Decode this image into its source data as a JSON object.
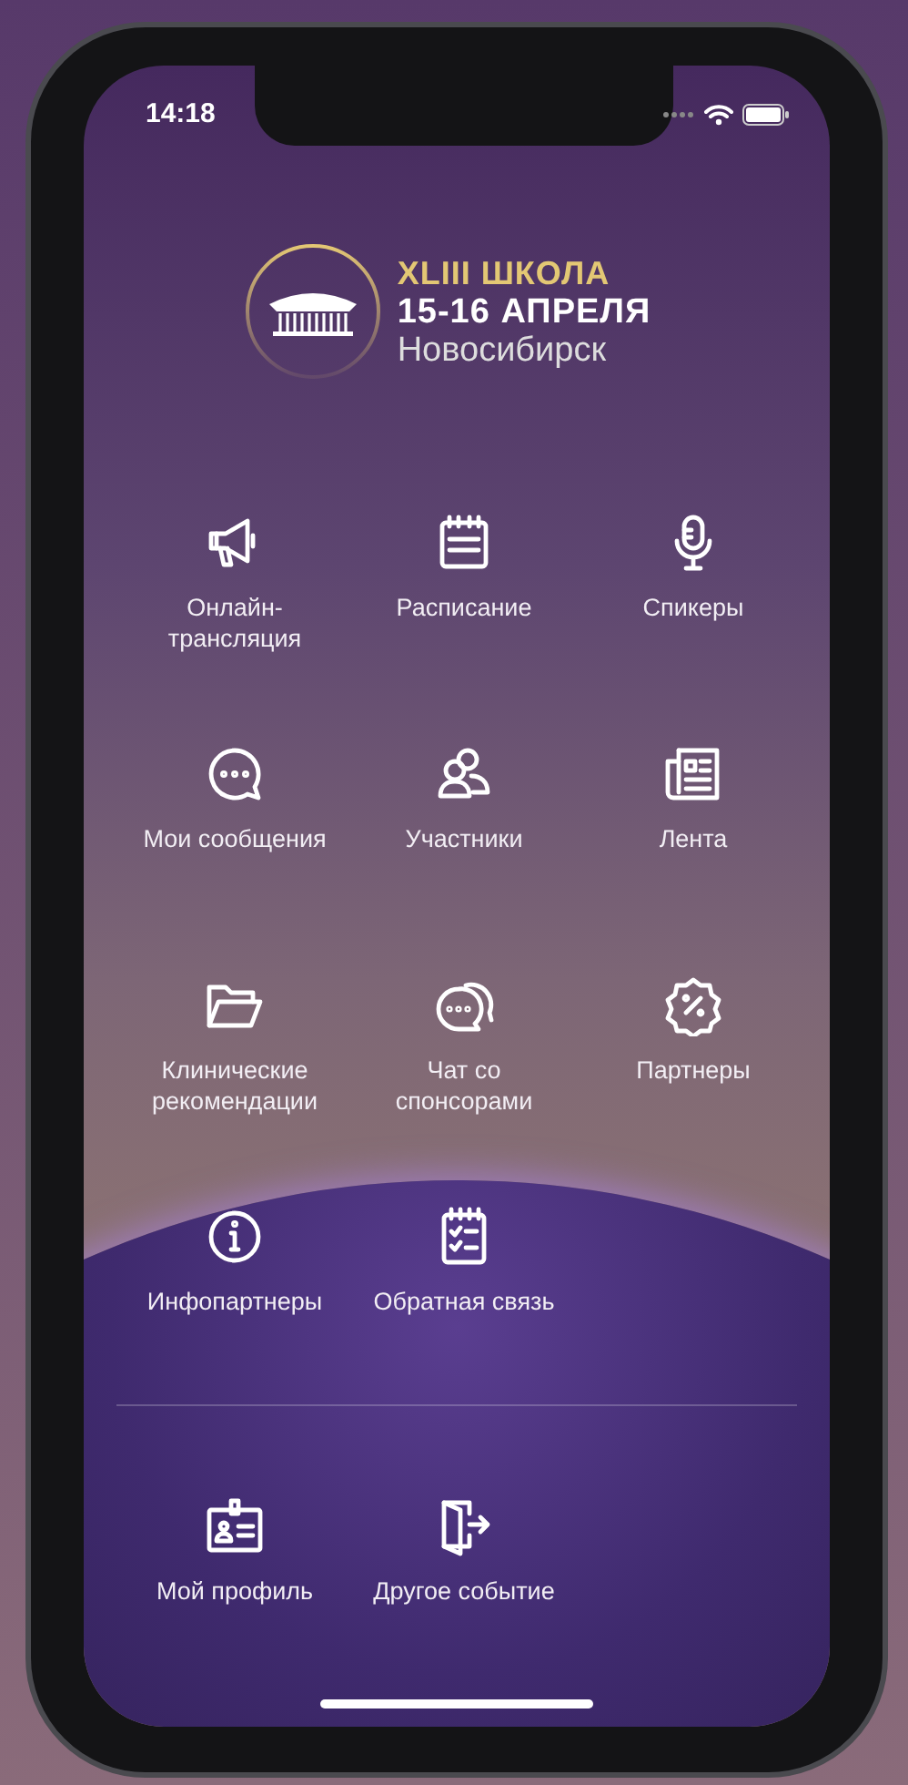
{
  "status_bar": {
    "time": "14:18"
  },
  "header": {
    "title": "XLIII ШКОЛА",
    "dates": "15-16 АПРЕЛЯ",
    "city": "Новосибирск"
  },
  "menu": [
    {
      "label": "Онлайн-трансляция"
    },
    {
      "label": "Расписание"
    },
    {
      "label": "Спикеры"
    },
    {
      "label": "Мои сообщения"
    },
    {
      "label": "Участники"
    },
    {
      "label": "Лента"
    },
    {
      "label": "Клинические рекомендации"
    },
    {
      "label": "Чат со спонсорами"
    },
    {
      "label": "Партнеры"
    },
    {
      "label": "Инфопартнеры"
    },
    {
      "label": "Обратная связь"
    }
  ],
  "bottom_menu": [
    {
      "label": "Мой профиль"
    },
    {
      "label": "Другое событие"
    }
  ]
}
